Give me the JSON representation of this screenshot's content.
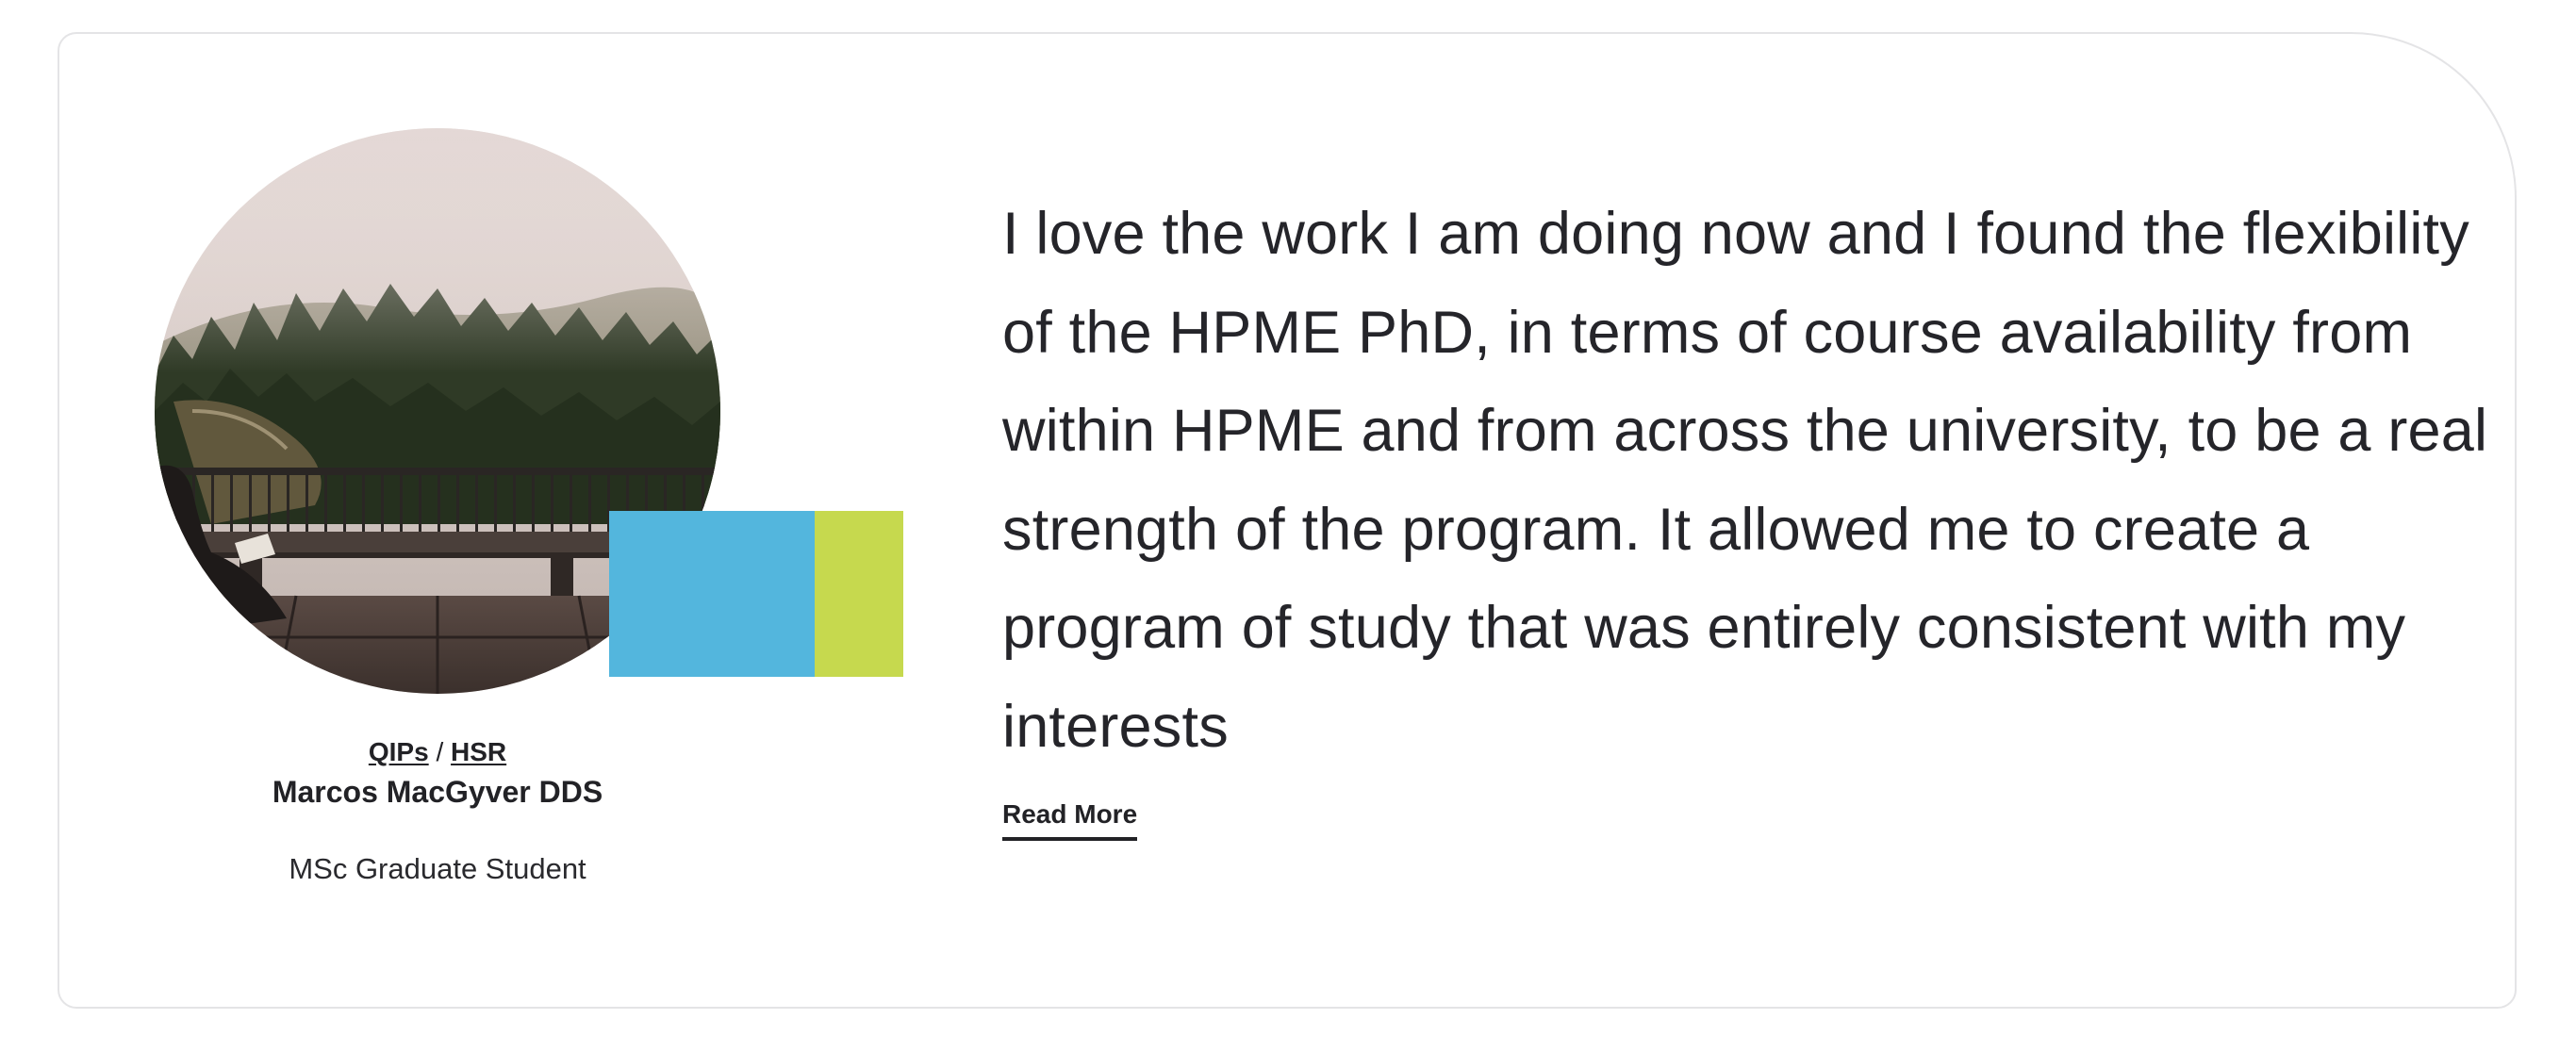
{
  "testimonial": {
    "photo": {
      "icon": "misty-forest-balcony-photo"
    },
    "accents": {
      "primary_color": "#53b6dd",
      "secondary_color": "#c6d94e"
    },
    "tags": [
      {
        "label": "QIPs"
      },
      {
        "label": "HSR"
      }
    ],
    "tag_separator": "/",
    "name": "Marcos MacGyver DDS",
    "role": "MSc Graduate Student",
    "quote": "I love the work I am doing now and I found the flexibility of the HPME PhD, in terms of course availability from within HPME and from across the university, to be a real strength of the program. It allowed me to create a program of study that was entirely consistent with my interests",
    "read_more_label": "Read More"
  }
}
